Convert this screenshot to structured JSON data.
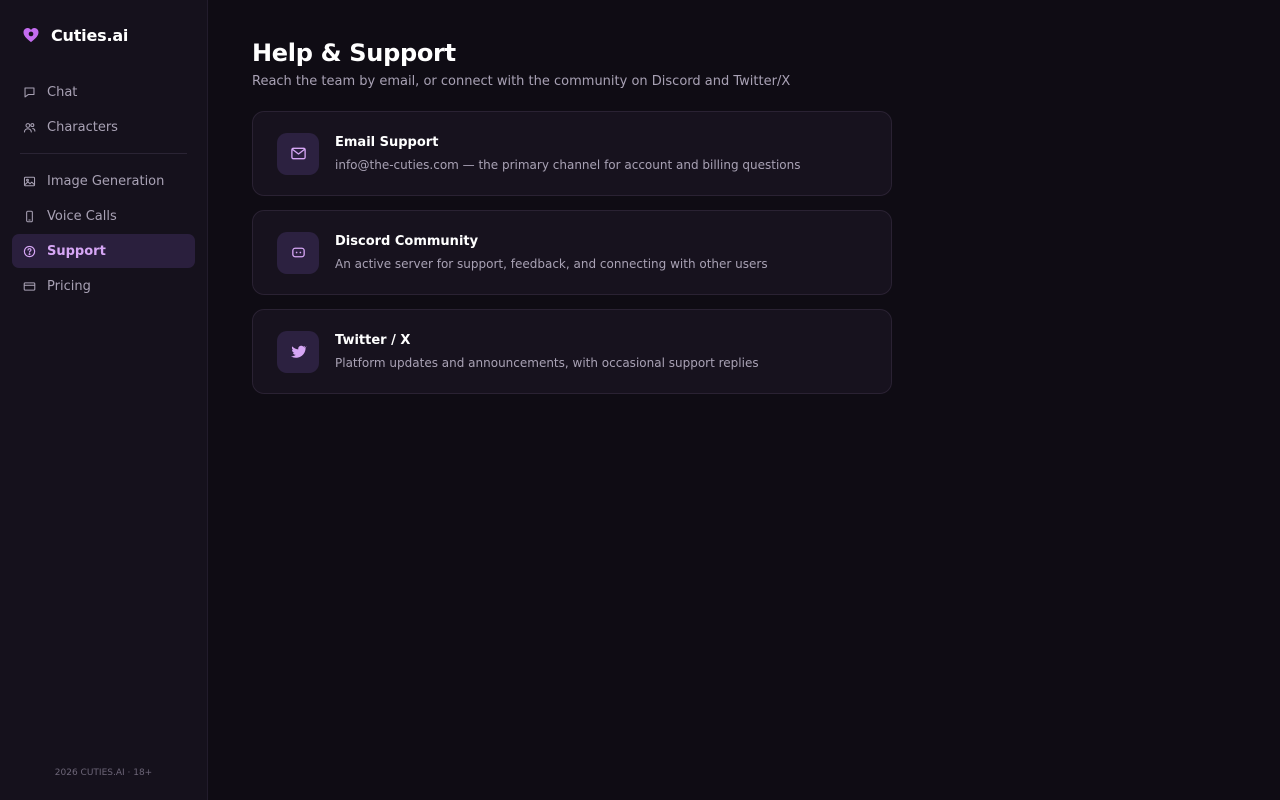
{
  "brand": {
    "name": "Cuties.ai",
    "logo_icon": "heart-icon",
    "accent": "#c46cf0"
  },
  "sidebar": {
    "items_top": [
      {
        "label": "Chat",
        "icon": "chat-icon"
      },
      {
        "label": "Characters",
        "icon": "users-icon"
      }
    ],
    "items_bottom": [
      {
        "label": "Image Generation",
        "icon": "image-icon"
      },
      {
        "label": "Voice Calls",
        "icon": "phone-icon"
      },
      {
        "label": "Support",
        "icon": "help-circle-icon",
        "active": true
      },
      {
        "label": "Pricing",
        "icon": "credit-card-icon"
      }
    ],
    "footer": "2026 CUTIES.AI · 18+"
  },
  "main": {
    "title": "Help & Support",
    "subtitle": "Reach the team by email, or connect with the community on Discord and Twitter/X",
    "cards": [
      {
        "title": "Email Support",
        "description": "info@the-cuties.com — the primary channel for account and billing questions",
        "icon": "mail-icon"
      },
      {
        "title": "Discord Community",
        "description": "An active server for support, feedback, and connecting with other users",
        "icon": "discord-icon"
      },
      {
        "title": "Twitter / X",
        "description": "Platform updates and announcements, with occasional support replies",
        "icon": "twitter-icon"
      }
    ]
  },
  "colors": {
    "background": "#0f0c14",
    "sidebar": "#15111c",
    "active_bg": "#2a1f3d",
    "active_text": "#d6a6f5",
    "card_bg": "#17121e",
    "icon_tile": "#2c2140"
  }
}
